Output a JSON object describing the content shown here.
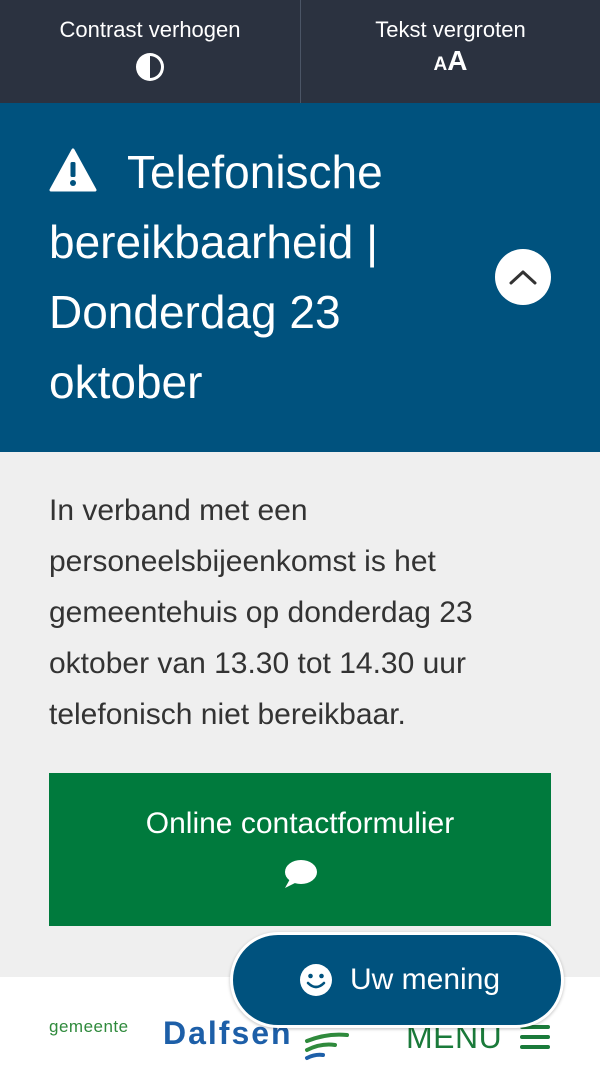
{
  "accessibility_bar": {
    "contrast": {
      "label": "Contrast verhogen",
      "icon": "contrast-icon"
    },
    "text_size": {
      "label": "Tekst vergroten",
      "icon_small": "A",
      "icon_big": "A"
    }
  },
  "notice": {
    "icon": "warning-icon",
    "title": "Telefonische bereikbaarheid | Donderdag 23 oktober",
    "toggle_icon": "chevron-up-icon",
    "body": "In verband met een personeelsbijeenkomst is het gemeentehuis op donderdag 23 oktober van 13.30 tot 14.30 uur telefonisch niet bereikbaar.",
    "cta": {
      "label": "Online contactformulier",
      "icon": "chat-bubble-icon"
    }
  },
  "header": {
    "logo": {
      "small": "gemeente",
      "big": "Dalfsen"
    },
    "menu": {
      "label": "MENU",
      "icon": "hamburger-icon"
    }
  },
  "feedback": {
    "label": "Uw mening",
    "icon": "smile-icon"
  },
  "colors": {
    "topbar": "#2b3240",
    "notice_header": "#00527e",
    "notice_body": "#efefef",
    "cta_green": "#007a3d",
    "menu_green": "#1a7a3a",
    "logo_blue": "#1d5fa8"
  }
}
